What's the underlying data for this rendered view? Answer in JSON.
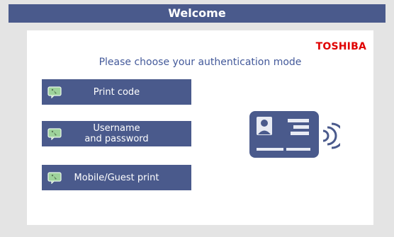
{
  "header": {
    "title": "Welcome"
  },
  "brand": {
    "name": "TOSHIBA",
    "color": "#e00000"
  },
  "main": {
    "instructions": "Please choose your authentication mode",
    "auth_options": [
      {
        "label": "Print code",
        "icon": "keypad-icon"
      },
      {
        "label": "Username\nand password",
        "icon": "keypad-icon"
      },
      {
        "label": "Mobile/Guest print",
        "icon": "keypad-icon"
      }
    ],
    "card_graphic": "id-card-contactless-icon"
  },
  "colors": {
    "primary": "#4a5a8c",
    "accent_text": "#43599a",
    "icon_green": "#9ed39b",
    "background": "#e4e4e4"
  }
}
